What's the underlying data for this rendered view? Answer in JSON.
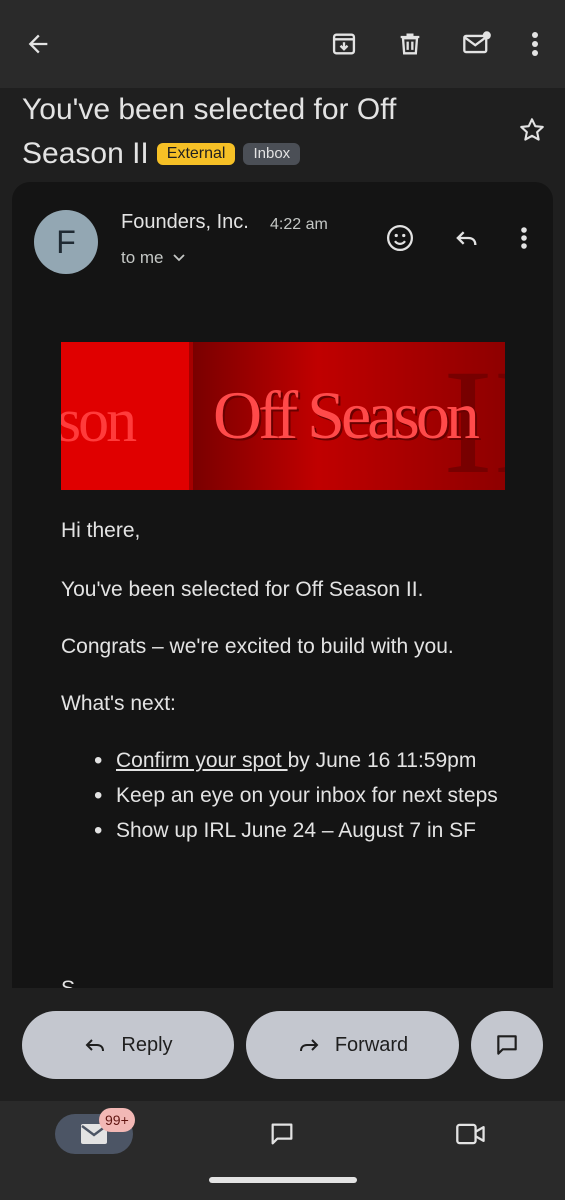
{
  "topbar": {
    "icons": [
      "back-arrow-icon",
      "archive-icon",
      "delete-icon",
      "mark-unread-icon",
      "more-vert-icon"
    ]
  },
  "subject": {
    "line1": "You've been selected for Off",
    "line2": "Season II",
    "labels": [
      "External",
      "Inbox"
    ],
    "star_icon": "star-outline-icon"
  },
  "message": {
    "avatar_letter": "F",
    "sender": "Founders, Inc.",
    "time": "4:22 am",
    "recipient": "to me",
    "banner": {
      "left_text": "son",
      "title": "Off Season",
      "numeral": "II"
    },
    "greeting": "Hi there,",
    "p1": "You've been selected for Off Season II.",
    "p2": "Congrats – we're excited to build with you.",
    "p3": "What's next:",
    "list": [
      {
        "link": "Confirm your spot ",
        "text": "by June 16 11:59pm"
      },
      {
        "text": "Keep an eye on your inbox for next steps"
      },
      {
        "text": "Show up IRL June 24 – August 7 in SF"
      }
    ],
    "cutoff": "S"
  },
  "actions": {
    "reply": "Reply",
    "forward": "Forward"
  },
  "bottom_nav": {
    "mail_count": "99+"
  },
  "colors": {
    "background": "#1f1f1f",
    "card": "#141414",
    "external_badge": "#f6c026",
    "pill": "#c4c7cf",
    "banner_red": "#d40000"
  }
}
